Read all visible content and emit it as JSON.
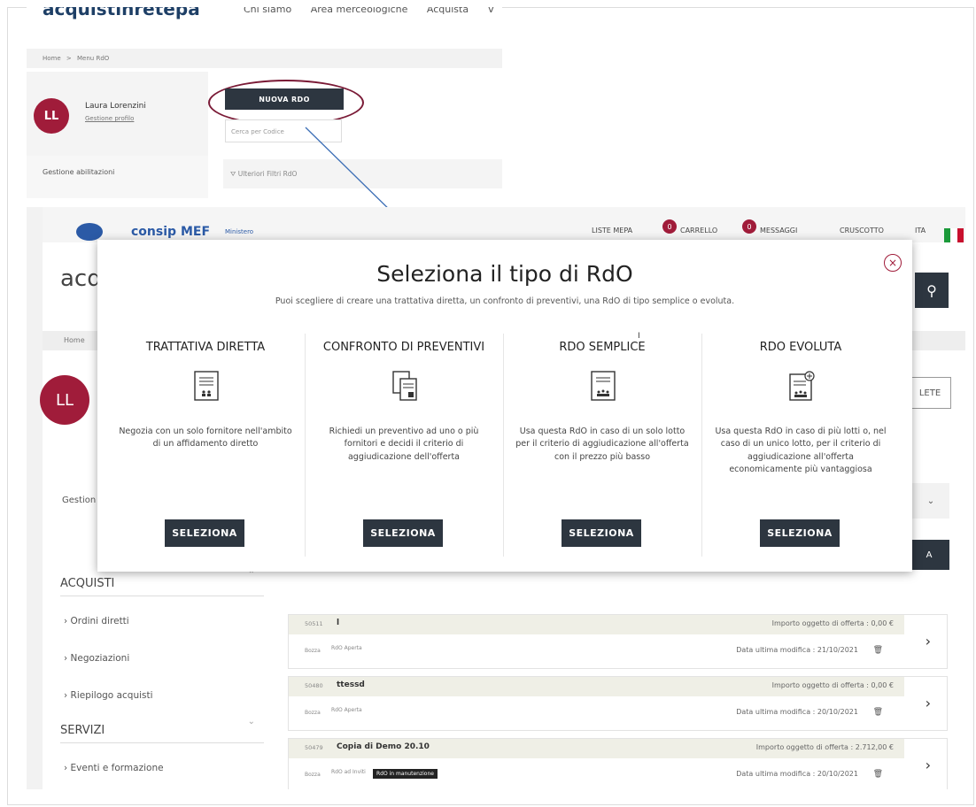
{
  "snippet": {
    "logo_text": "acquistinretepa",
    "nav": [
      "Chi siamo",
      "Area merceologiche",
      "Acquista",
      "V"
    ],
    "breadcrumb": [
      "Home",
      ">",
      "Menu RdO"
    ],
    "user": {
      "initials": "LL",
      "name": "Laura Lorenzini",
      "profile_link": "Gestione profilo"
    },
    "abilitazioni": "Gestione abilitazioni",
    "new_rdo_button": "NUOVA RDO",
    "search_placeholder": "Cerca per Codice",
    "filters_label": "Ulteriori Filtri RdO"
  },
  "background": {
    "logo_consip": "consip",
    "logo_mef": "MEF",
    "logo_ministero": "Ministero",
    "top_nav": [
      "LISTE MEPA",
      "CARRELLO",
      "MESSAGGI",
      "CRUSCOTTO",
      "ITA"
    ],
    "badges": [
      "0",
      "0"
    ],
    "site_title": "acq",
    "breadcrumb": "Home",
    "avatar": "LL",
    "gestion": "Gestion",
    "plete_button": "LETE",
    "dark_button_fragment": "A",
    "sidebar": {
      "acquisti": "ACQUISTI",
      "items": [
        "Ordini diretti",
        "Negoziazioni",
        "Riepilogo acquisti"
      ],
      "servizi": "SERVIZI",
      "servizi_items": [
        "Eventi e formazione"
      ]
    },
    "rows": [
      {
        "id": "50511",
        "title": "l",
        "importo": "Importo oggetto di offerta : 0,00 €",
        "status": "Bozza",
        "tags": [
          "RdO Aperta"
        ],
        "date": "Data ultima modifica : 21/10/2021"
      },
      {
        "id": "50480",
        "title": "ttessd",
        "importo": "Importo oggetto di offerta : 0,00 €",
        "status": "Bozza",
        "tags": [
          "RdO Aperta"
        ],
        "date": "Data ultima modifica : 20/10/2021"
      },
      {
        "id": "50479",
        "title": "Copia di Demo 20.10",
        "importo": "Importo oggetto di offerta : 2.712,00 €",
        "status": "Bozza",
        "tags": [
          "RdO ad Inviti",
          "RdO in manutenzione"
        ],
        "date": "Data ultima modifica : 20/10/2021"
      }
    ]
  },
  "modal": {
    "title": "Seleziona il tipo di RdO",
    "subtitle": "Puoi scegliere di creare una trattativa diretta, un confronto di preventivi, una RdO di tipo semplice o evoluta.",
    "options": [
      {
        "title": "TRATTATIVA DIRETTA",
        "desc": "Negozia con un solo fornitore nell'ambito di un affidamento diretto",
        "button": "SELEZIONA"
      },
      {
        "title": "CONFRONTO DI PREVENTIVI",
        "desc": "Richiedi un preventivo ad uno o più fornitori e decidi il criterio di aggiudicazione dell'offerta",
        "button": "SELEZIONA"
      },
      {
        "title": "RDO SEMPLICE",
        "desc": "Usa questa RdO in caso di un solo lotto per il criterio di aggiudicazione all'offerta con il prezzo più basso",
        "button": "SELEZIONA"
      },
      {
        "title": "RDO EVOLUTA",
        "desc": "Usa questa RdO in caso di più lotti o, nel caso di un unico lotto, per il criterio di aggiudicazione all'offerta economicamente più vantaggiosa",
        "button": "SELEZIONA"
      }
    ]
  },
  "colors": {
    "brand_red": "#a01c3a",
    "dark_button": "#2d3640",
    "annotation_arrow": "#3d6fb6"
  }
}
